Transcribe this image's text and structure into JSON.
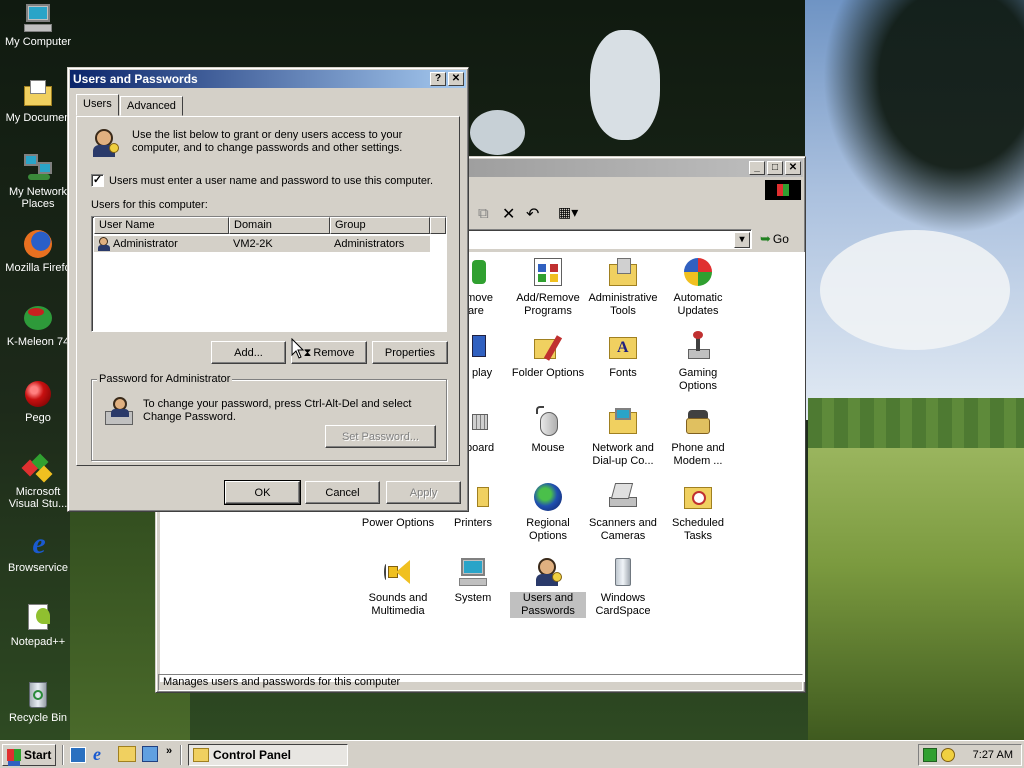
{
  "desktop": {
    "icons": [
      {
        "label": "My Computer",
        "icon": "my-computer-icon"
      },
      {
        "label": "My Documen",
        "icon": "my-documents-icon"
      },
      {
        "label": "My Network Places",
        "icon": "network-places-icon"
      },
      {
        "label": "Mozilla Firefo",
        "icon": "firefox-icon"
      },
      {
        "label": "K-Meleon 74",
        "icon": "kmeleon-icon"
      },
      {
        "label": "Pego",
        "icon": "pego-icon"
      },
      {
        "label": "Microsoft Visual Stu...",
        "icon": "visual-studio-icon"
      },
      {
        "label": "Browservice",
        "icon": "browservice-icon"
      },
      {
        "label": "Notepad++",
        "icon": "notepadpp-icon"
      },
      {
        "label": "Recycle Bin",
        "icon": "recycle-bin-icon"
      }
    ]
  },
  "control_panel": {
    "toolbar": {
      "go_label": "Go"
    },
    "status_text": "Manages users and passwords for this computer",
    "items": [
      {
        "label": "emove\nware",
        "icon": "add-remove-hardware-icon"
      },
      {
        "label": "Add/Remove Programs",
        "icon": "add-remove-programs-icon"
      },
      {
        "label": "Administrative Tools",
        "icon": "administrative-tools-icon"
      },
      {
        "label": "Automatic Updates",
        "icon": "automatic-updates-icon"
      },
      {
        "label": "play",
        "icon": "display-icon"
      },
      {
        "label": "Folder Options",
        "icon": "folder-options-icon"
      },
      {
        "label": "Fonts",
        "icon": "fonts-icon"
      },
      {
        "label": "Gaming Options",
        "icon": "gaming-options-icon"
      },
      {
        "label": "board",
        "icon": "keyboard-icon"
      },
      {
        "label": "Mouse",
        "icon": "mouse-icon"
      },
      {
        "label": "Network and Dial-up Co...",
        "icon": "network-dialup-icon"
      },
      {
        "label": "Phone and Modem ...",
        "icon": "phone-modem-icon"
      },
      {
        "label": "Power Options",
        "icon": "power-options-icon"
      },
      {
        "label": "Printers",
        "icon": "printers-icon"
      },
      {
        "label": "Regional Options",
        "icon": "regional-options-icon"
      },
      {
        "label": "Scanners and Cameras",
        "icon": "scanners-cameras-icon"
      },
      {
        "label": "Scheduled Tasks",
        "icon": "scheduled-tasks-icon"
      },
      {
        "label": "Sounds and Multimedia",
        "icon": "sounds-multimedia-icon"
      },
      {
        "label": "System",
        "icon": "system-icon"
      },
      {
        "label": "Users and Passwords",
        "icon": "users-passwords-icon"
      },
      {
        "label": "Windows CardSpace",
        "icon": "cardspace-icon"
      }
    ]
  },
  "dialog": {
    "title": "Users and Passwords",
    "tabs": [
      "Users",
      "Advanced"
    ],
    "intro": "Use the list below to grant or deny users access to your computer, and to change passwords and other settings.",
    "must_login_label": "Users must enter a user name and password to use this computer.",
    "must_login_checked": true,
    "users_label": "Users for this computer:",
    "columns": [
      "User Name",
      "Domain",
      "Group"
    ],
    "users": [
      {
        "name": "Administrator",
        "domain": "VM2-2K",
        "group": "Administrators"
      }
    ],
    "buttons": {
      "add": "Add...",
      "remove": "Remove",
      "properties": "Properties",
      "set_password": "Set Password...",
      "ok": "OK",
      "cancel": "Cancel",
      "apply": "Apply"
    },
    "password_group_label": "Password for Administrator",
    "password_text": "To change your password, press Ctrl-Alt-Del and select Change Password."
  },
  "taskbar": {
    "start_label": "Start",
    "task_label": "Control Panel",
    "clock": "7:27 AM"
  },
  "colors": {
    "title_active": "#0a246a",
    "title_active_end": "#a6caf0",
    "face": "#d4d0c8",
    "selection": "#0a246a"
  }
}
